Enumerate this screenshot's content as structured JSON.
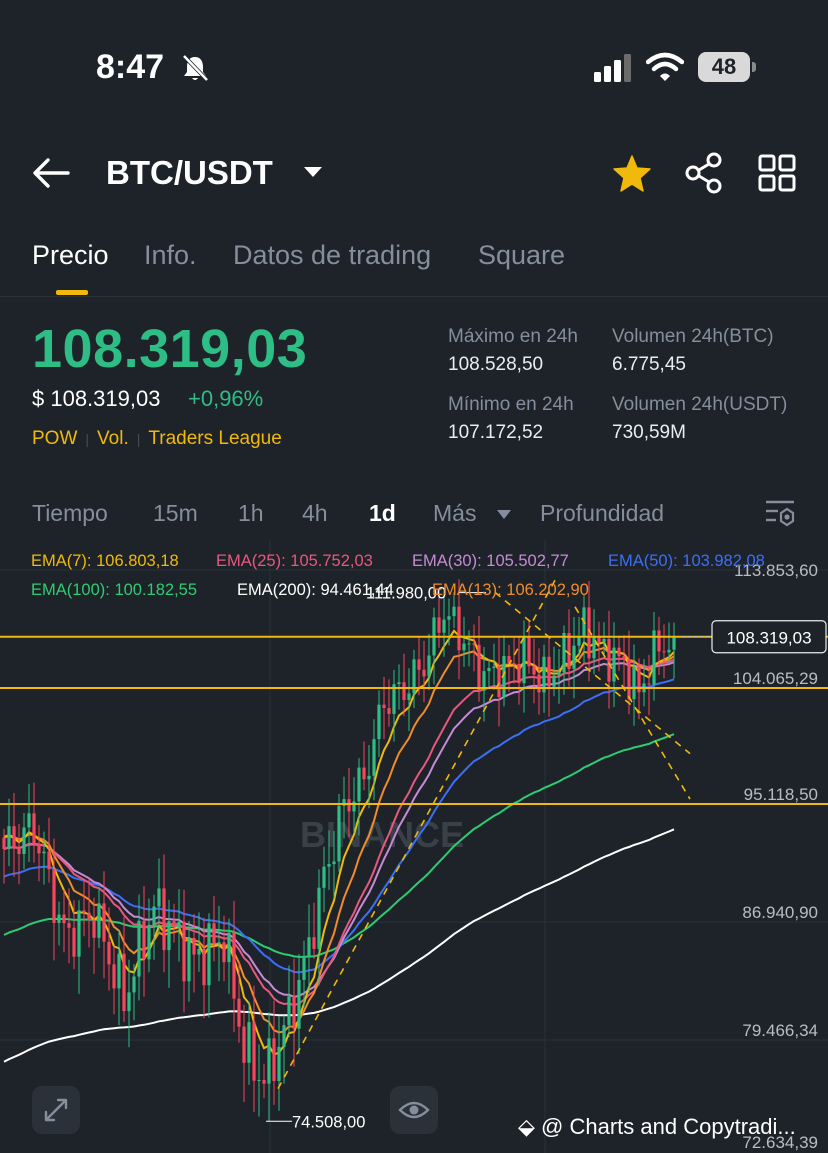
{
  "status_bar": {
    "time": "8:47",
    "battery": "48"
  },
  "header": {
    "pair": "BTC/USDT"
  },
  "tabs": [
    "Precio",
    "Info.",
    "Datos de trading",
    "Square"
  ],
  "price": {
    "last": "108.319,03",
    "usd": "$ 108.319,03",
    "change": "+0,96%",
    "tags": [
      "POW",
      "Vol.",
      "Traders League"
    ]
  },
  "stats": {
    "high_label": "Máximo en 24h",
    "high_value": "108.528,50",
    "low_label": "Mínimo en 24h",
    "low_value": "107.172,52",
    "vol_btc_label": "Volumen 24h(BTC)",
    "vol_btc_value": "6.775,45",
    "vol_usdt_label": "Volumen 24h(USDT)",
    "vol_usdt_value": "730,59M"
  },
  "intervals": [
    "Tiempo",
    "15m",
    "1h",
    "4h",
    "1d",
    "Más",
    "Profundidad"
  ],
  "colors": {
    "up": "#2ebd85",
    "down": "#f6465d",
    "accent": "#f0b90b",
    "ema7": "#f0b90b",
    "ema25": "#e8577f",
    "ema30": "#c58bd6",
    "ema50": "#3b6ff5",
    "ema100": "#2ecc71",
    "ema200": "#ffffff",
    "ema13": "#f08c2a"
  },
  "chart_data": {
    "type": "candlestick",
    "indicators": [
      {
        "label": "EMA(7): 106.803,18",
        "color": "#f0b90b"
      },
      {
        "label": "EMA(25): 105.752,03",
        "color": "#e8577f"
      },
      {
        "label": "EMA(30): 105.502,77",
        "color": "#c58bd6"
      },
      {
        "label": "EMA(50): 103.982,08",
        "color": "#3b6ff5"
      },
      {
        "label": "EMA(100): 100.182,55",
        "color": "#2ecc71"
      },
      {
        "label": "EMA(200): 94.461,44",
        "color": "#ffffff"
      },
      {
        "label": "EMA(13): 106.202,90",
        "color": "#f08c2a"
      }
    ],
    "y_ticks": [
      "113.853,60",
      "104.065,29",
      "95.118,50",
      "86.940,90",
      "79.466,34",
      "72.634,39"
    ],
    "y_tick_values": [
      113853.6,
      104065.29,
      95118.5,
      86940.9,
      79466.34,
      72634.39
    ],
    "current_price_label": "108.319,03",
    "current_price": 108319.03,
    "high_annotation": "111.980,00",
    "high_value": 111980,
    "low_annotation": "74.508,00",
    "low_value": 74508,
    "horizontal_levels": [
      108319.03,
      104065.29,
      95118.5
    ]
  },
  "watermark": "BINANCE",
  "credit": "@ Charts and Copytradi..."
}
